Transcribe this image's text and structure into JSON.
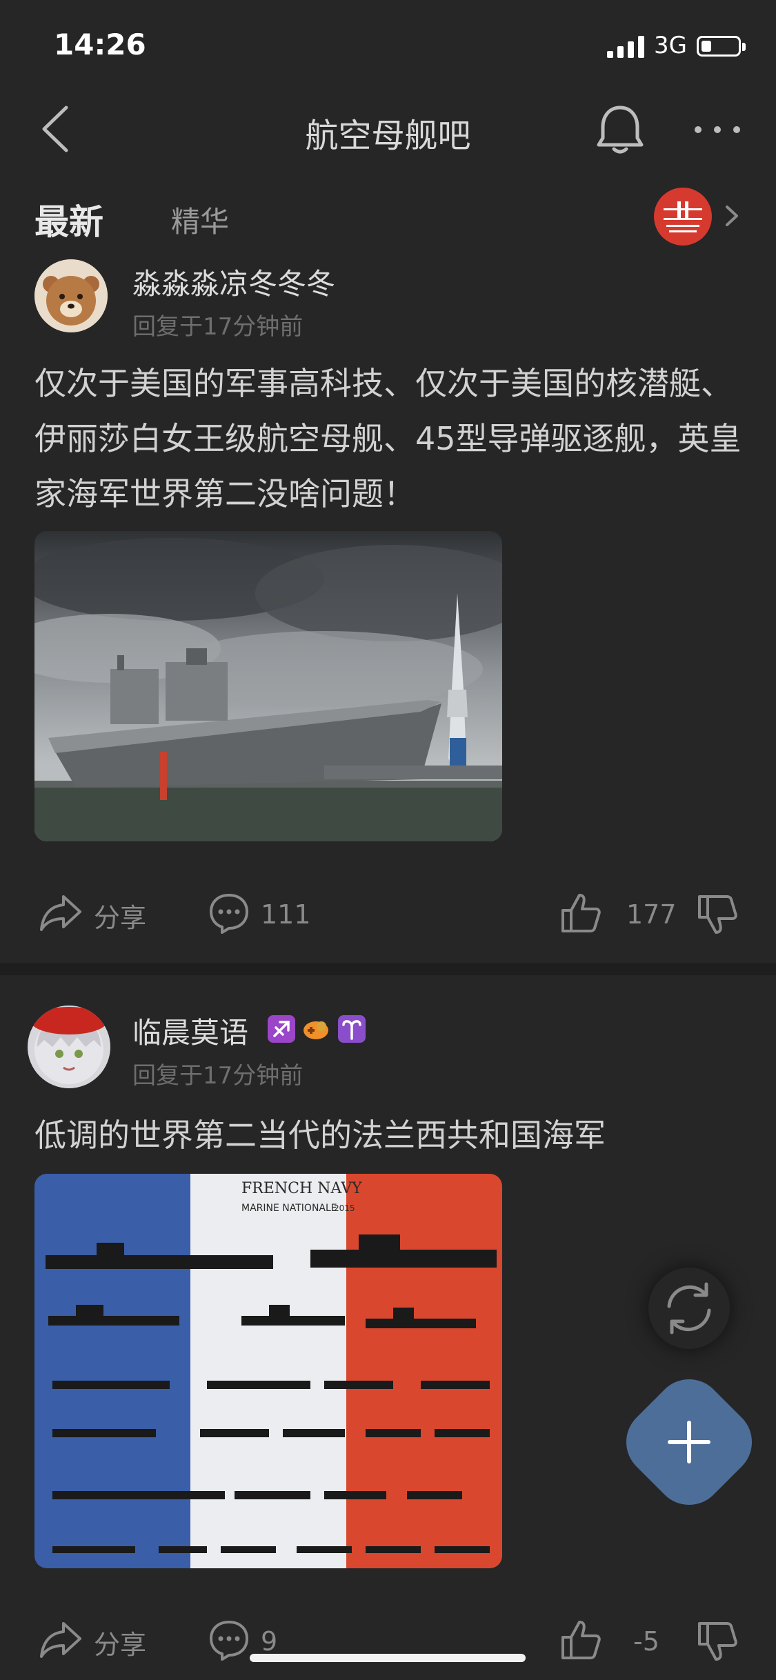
{
  "status_bar": {
    "time": "14:26",
    "network": "3G"
  },
  "nav": {
    "title": "航空母舰吧"
  },
  "tabs": {
    "latest": "最新",
    "featured": "精华"
  },
  "posts": [
    {
      "username": "淼淼淼凉冬冬冬",
      "meta": "回复于17分钟前",
      "content": "仅次于美国的军事高科技、仅次于美国的核潜艇、伊丽莎白女王级航空母舰、45型导弹驱逐舰，英皇家海军世界第二没啥问题！",
      "image": "aircraft-carrier-photo",
      "share_label": "分享",
      "comments": "111",
      "likes": "177"
    },
    {
      "username": "临晨莫语",
      "meta": "回复于17分钟前",
      "content": "低调的世界第二当代的法兰西共和国海军",
      "image": "french-navy-poster",
      "poster_title": "FRENCH NAVY",
      "poster_subtitle": "MARINE NATIONALE",
      "poster_year": "2015",
      "share_label": "分享",
      "comments": "9",
      "likes": "-5"
    }
  ],
  "colors": {
    "background": "#262626",
    "accent": "#4e6e9a",
    "live": "#d63a2f"
  }
}
